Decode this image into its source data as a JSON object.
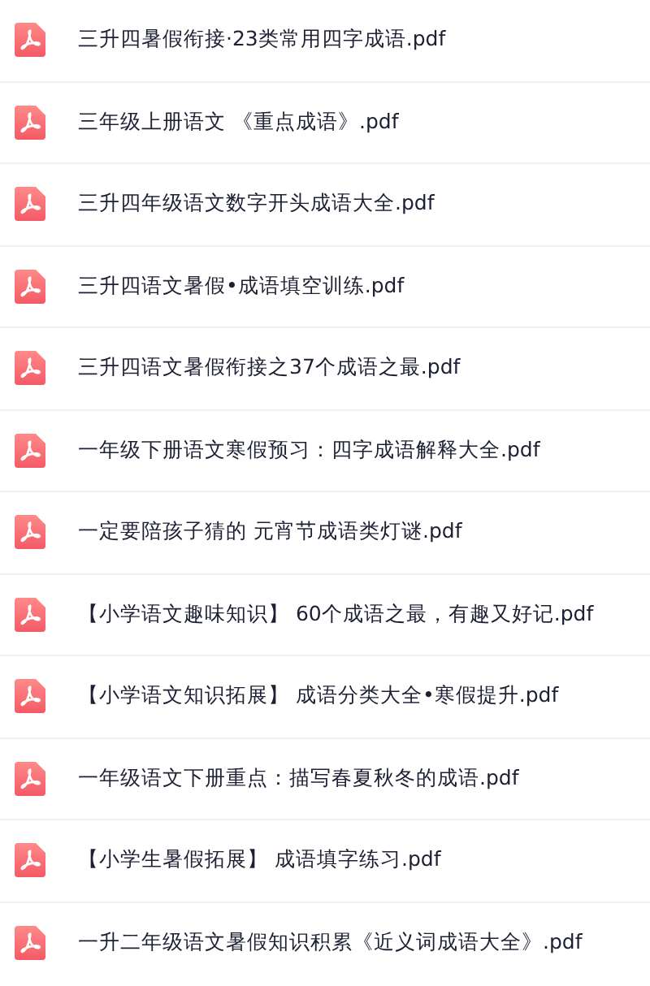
{
  "files": [
    {
      "name": "三升四暑假衔接·23类常用四字成语.pdf"
    },
    {
      "name": "三年级上册语文 《重点成语》.pdf"
    },
    {
      "name": "三升四年级语文数字开头成语大全.pdf"
    },
    {
      "name": "三升四语文暑假•成语填空训练.pdf"
    },
    {
      "name": "三升四语文暑假衔接之37个成语之最.pdf"
    },
    {
      "name": "一年级下册语文寒假预习：四字成语解释大全.pdf"
    },
    {
      "name": "一定要陪孩子猜的 元宵节成语类灯谜.pdf"
    },
    {
      "name": "【小学语文趣味知识】 60个成语之最，有趣又好记.pdf"
    },
    {
      "name": "【小学语文知识拓展】 成语分类大全•寒假提升.pdf"
    },
    {
      "name": "一年级语文下册重点：描写春夏秋冬的成语.pdf"
    },
    {
      "name": "【小学生暑假拓展】 成语填字练习.pdf"
    },
    {
      "name": "一升二年级语文暑假知识积累《近义词成语大全》.pdf"
    }
  ]
}
